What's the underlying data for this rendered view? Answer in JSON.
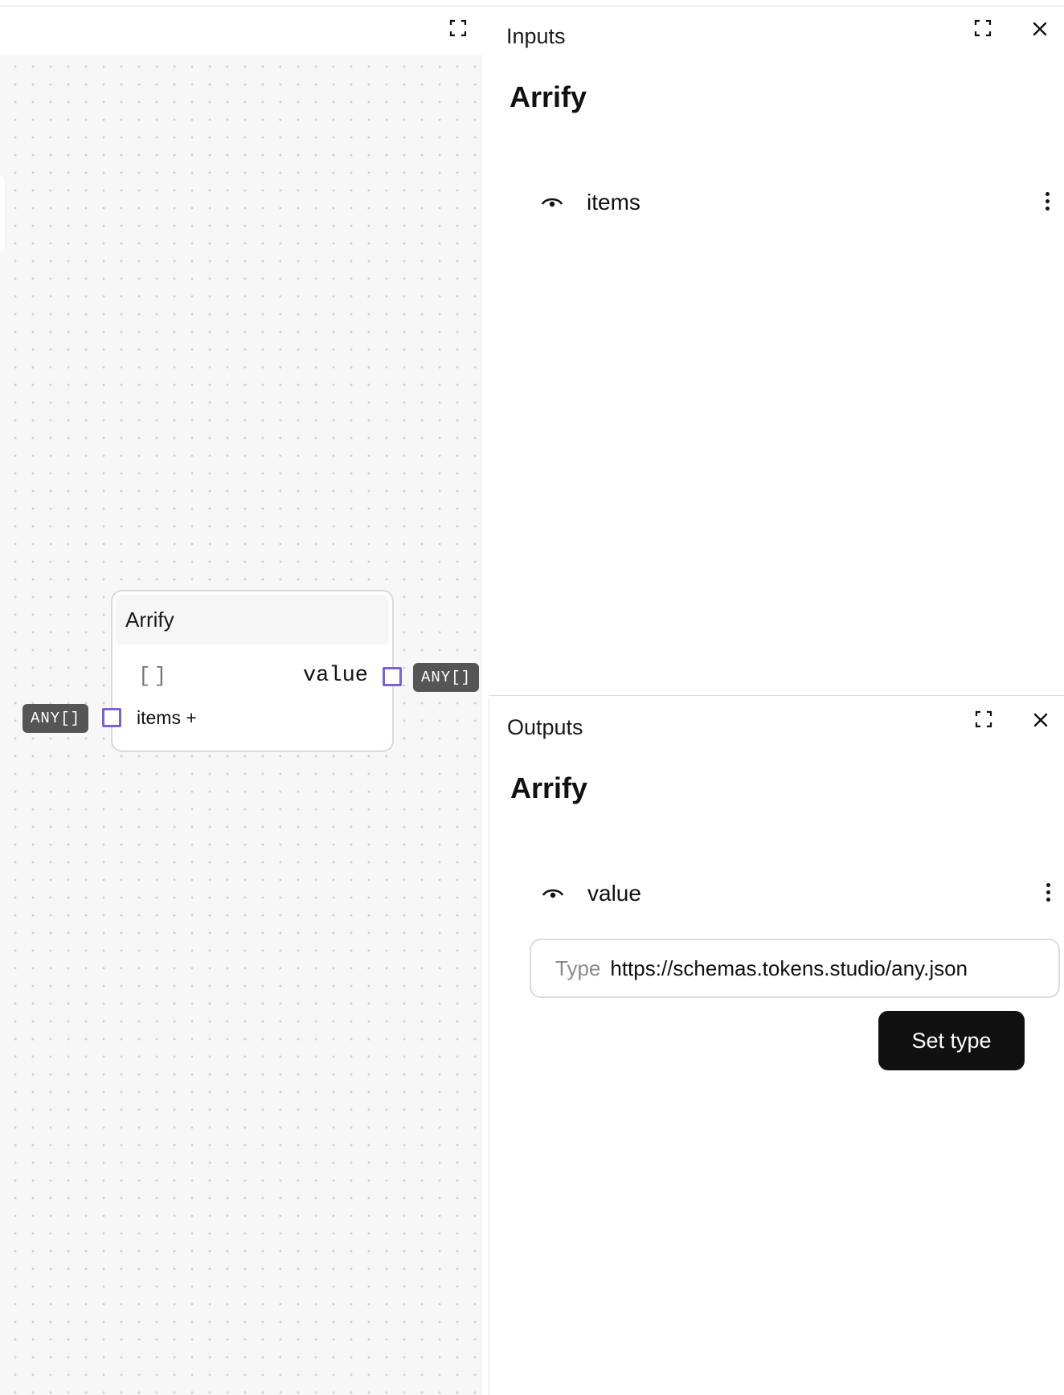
{
  "canvas": {
    "node": {
      "title": "Arrify",
      "default_value": "[]",
      "output_label": "value",
      "input_label": "items +",
      "output_type": "ANY[]",
      "input_type": "ANY[]"
    },
    "port_color": "#7b61d6"
  },
  "inputs_panel": {
    "title": "Inputs",
    "node_name": "Arrify",
    "rows": [
      {
        "label": "items"
      }
    ]
  },
  "outputs_panel": {
    "title": "Outputs",
    "node_name": "Arrify",
    "rows": [
      {
        "label": "value"
      }
    ],
    "type_field": {
      "label": "Type",
      "value": "https://schemas.tokens.studio/any.json"
    },
    "set_type_label": "Set type"
  },
  "icons": [
    "expand-icon",
    "close-icon",
    "eye-icon",
    "kebab-icon"
  ]
}
